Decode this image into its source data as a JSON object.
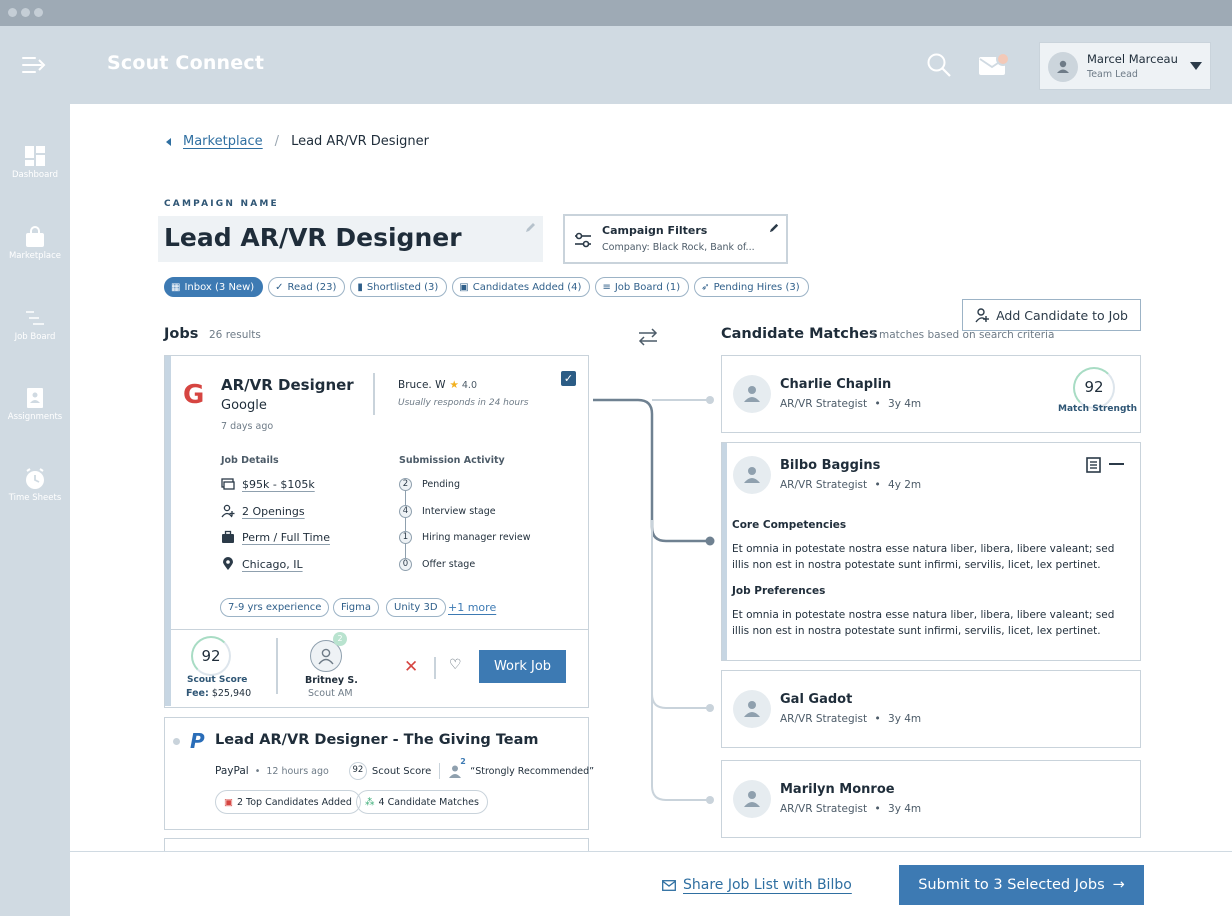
{
  "app": {
    "title": "Scout Connect"
  },
  "user": {
    "name": "Marcel Marceau",
    "role": "Team Lead"
  },
  "sidebar": {
    "items": [
      {
        "label": "Dashboard"
      },
      {
        "label": "Marketplace"
      },
      {
        "label": "Job Board"
      },
      {
        "label": "Assignments"
      },
      {
        "label": "Time Sheets"
      }
    ]
  },
  "breadcrumb": {
    "parent": "Marketplace",
    "current": "Lead AR/VR Designer"
  },
  "campaign": {
    "label": "CAMPAIGN NAME",
    "name": "Lead AR/VR Designer"
  },
  "filters": {
    "title": "Campaign Filters",
    "summary": "Company: Black Rock, Bank of..."
  },
  "tabs": [
    {
      "label": "Inbox (3 New)",
      "icon": "grid-icon",
      "active": true
    },
    {
      "label": "Read (23)",
      "icon": "double-check-icon"
    },
    {
      "label": "Shortlisted (3)",
      "icon": "bookmark-icon"
    },
    {
      "label": "Candidates Added (4)",
      "icon": "calendar-icon"
    },
    {
      "label": "Job Board (1)",
      "icon": "filter-icon"
    },
    {
      "label": "Pending Hires (3)",
      "icon": "rocket-icon"
    }
  ],
  "jobs": {
    "title": "Jobs",
    "count": "26 results",
    "featured": {
      "logo": "G",
      "title": "AR/VR Designer",
      "company": "Google",
      "age": "7 days ago",
      "recruiter": "Bruce. W",
      "rating": "4.0",
      "responds": "Usually responds in 24 hours",
      "details_title": "Job Details",
      "details": [
        {
          "icon": "salary-icon",
          "value": "$95k - $105k"
        },
        {
          "icon": "openings-icon",
          "value": "2 Openings"
        },
        {
          "icon": "briefcase-icon",
          "value": "Perm / Full Time"
        },
        {
          "icon": "location-pin-icon",
          "value": "Chicago, IL"
        }
      ],
      "activity_title": "Submission Activity",
      "activity": [
        {
          "count": "2",
          "label": "Pending"
        },
        {
          "count": "4",
          "label": "Interview stage"
        },
        {
          "count": "1",
          "label": "Hiring manager review"
        },
        {
          "count": "0",
          "label": "Offer stage"
        }
      ],
      "skills": [
        "7-9 yrs experience",
        "Figma",
        "Unity 3D"
      ],
      "more": "+1 more",
      "scout_score": "92",
      "scout_score_label": "Scout Score",
      "fee_label": "Fee:",
      "fee": "$25,940",
      "am_name": "Britney S.",
      "am_role": "Scout AM",
      "am_badge": "2",
      "work_label": "Work Job"
    },
    "second": {
      "title": "Lead AR/VR Designer - The Giving Team",
      "company": "PayPal",
      "age": "12 hours ago",
      "score": "92",
      "score_label": "Scout Score",
      "endorse_count": "2",
      "endorsement": "“Strongly Recommended”",
      "pill1": "2 Top Candidates Added",
      "pill2": "4 Candidate Matches"
    }
  },
  "candidates": {
    "title": "Candidate Matches",
    "subtitle": "3 matches based on search criteria",
    "add_label": "Add Candidate to Job",
    "items": [
      {
        "name": "Charlie Chaplin",
        "role": "AR/VR Strategist",
        "exp": "3y 4m",
        "score": "92",
        "score_label": "Match Strength"
      },
      {
        "name": "Bilbo Baggins",
        "role": "AR/VR Strategist",
        "exp": "4y 2m",
        "sec1": "Core Competencies",
        "text1": "Et omnia in potestate nostra esse natura liber, libera, libere valeant; sed illis non est in nostra potestate sunt infirmi, servilis, licet, lex pertinet.",
        "sec2": "Job Preferences",
        "text2": "Et omnia in potestate nostra esse natura liber, libera, libere valeant; sed illis non est in nostra potestate sunt infirmi, servilis, licet, lex pertinet."
      },
      {
        "name": "Gal Gadot",
        "role": "AR/VR Strategist",
        "exp": "3y 4m"
      },
      {
        "name": "Marilyn Monroe",
        "role": "AR/VR Strategist",
        "exp": "3y 4m"
      }
    ]
  },
  "footer": {
    "share": "Share Job List with Bilbo",
    "submit": "Submit to 3 Selected Jobs"
  },
  "colors": {
    "primary": "#3d7ab3",
    "header": "#d0dae2",
    "accent_red": "#d64541",
    "star": "#f2b01e"
  }
}
